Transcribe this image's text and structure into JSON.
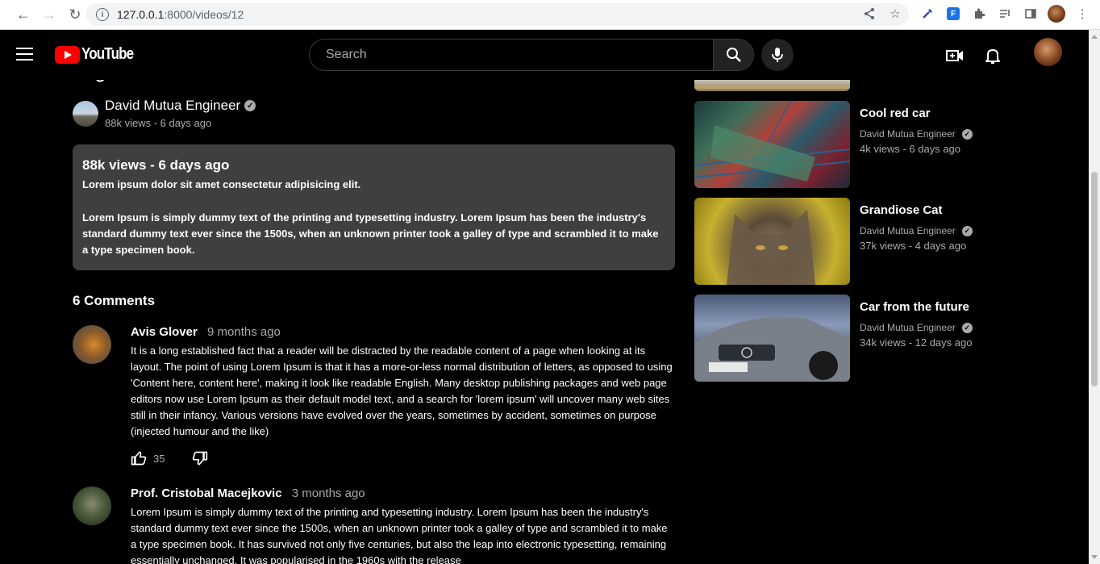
{
  "browser": {
    "url_host": "127.0.0.1",
    "url_path": ":8000/videos/12"
  },
  "header": {
    "logo_text": "YouTube",
    "search_placeholder": "Search"
  },
  "video": {
    "title": "Dog in Winter",
    "channel_name": "David Mutua Engineer",
    "meta": "88k views - 6 days ago"
  },
  "description": {
    "views_line": "88k views - 6 days ago",
    "short": "Lorem ipsum dolor sit amet consectetur adipisicing elit.",
    "long": "Lorem Ipsum is simply dummy text of the printing and typesetting industry. Lorem Ipsum has been the industry's standard dummy text ever since the 1500s, when an unknown printer took a galley of type and scrambled it to make a type specimen book."
  },
  "comments": {
    "count_label": "6 Comments",
    "items": [
      {
        "author": "Avis Glover",
        "time": "9 months ago",
        "text": "It is a long established fact that a reader will be distracted by the readable content of a page when looking at its layout. The point of using Lorem Ipsum is that it has a more-or-less normal distribution of letters, as opposed to using 'Content here, content here', making it look like readable English. Many desktop publishing packages and web page editors now use Lorem Ipsum as their default model text, and a search for 'lorem ipsum' will uncover many web sites still in their infancy. Various versions have evolved over the years, sometimes by accident, sometimes on purpose (injected humour and the like)",
        "likes": "35"
      },
      {
        "author": "Prof. Cristobal Macejkovic",
        "time": "3 months ago",
        "text": "Lorem Ipsum is simply dummy text of the printing and typesetting industry. Lorem Ipsum has been the industry's standard dummy text ever since the 1500s, when an unknown printer took a galley of type and scrambled it to make a type specimen book. It has survived not only five centuries, but also the leap into electronic typesetting, remaining essentially unchanged. It was popularised in the 1960s with the release"
      }
    ]
  },
  "related": [
    {
      "title": "Cool red car",
      "channel": "David Mutua Engineer",
      "meta": "4k views - 6 days ago"
    },
    {
      "title": "Grandiose Cat",
      "channel": "David Mutua Engineer",
      "meta": "37k views - 4 days ago"
    },
    {
      "title": "Car from the future",
      "channel": "David Mutua Engineer",
      "meta": "34k views - 12 days ago"
    }
  ]
}
